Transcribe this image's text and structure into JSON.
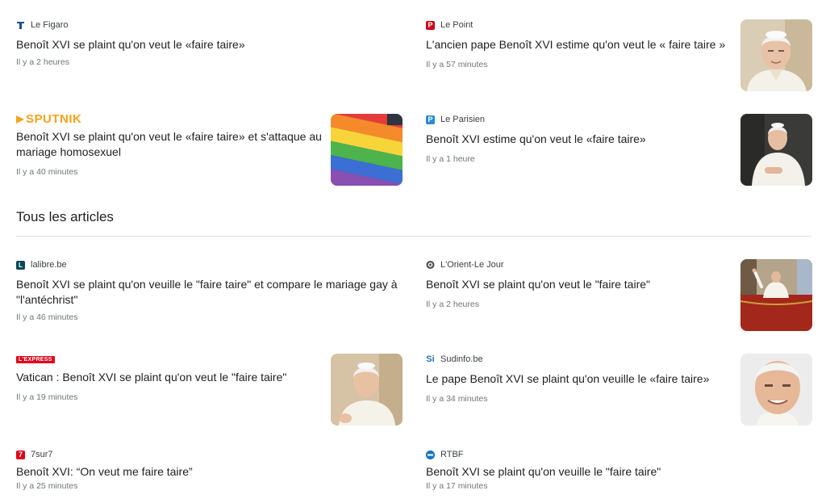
{
  "featured": [
    {
      "source": "Le Figaro",
      "headline": "Benoît XVI se plaint qu'on veut le «faire taire»",
      "time": "Il y a 2 heures"
    },
    {
      "source": "Le Point",
      "logo_letter": "P",
      "headline": "L'ancien pape Benoît XVI estime qu'on veut le « faire taire »",
      "time": "Il y a 57 minutes"
    },
    {
      "source": "SPUTNIK",
      "headline": "Benoît XVI se plaint qu'on veut le «faire taire» et s'attaque au mariage homosexuel",
      "time": "Il y a 40 minutes"
    },
    {
      "source": "Le Parisien",
      "logo_letter": "P",
      "headline": "Benoît XVI estime qu'on veut le «faire taire»",
      "time": "Il y a 1 heure"
    }
  ],
  "section": {
    "title": "Tous les articles"
  },
  "articles": [
    {
      "source": "lalibre.be",
      "logo_letter": "L",
      "headline": "Benoît XVI se plaint qu'on veuille le \"faire taire\" et compare le mariage gay à \"l'antéchrist\"",
      "time": "Il y a 46 minutes"
    },
    {
      "source": "L'Orient-Le Jour",
      "headline": "Benoît XVI se plaint qu'on veut le \"faire taire\"",
      "time": "Il y a 2 heures"
    },
    {
      "source": "L'EXPRESS",
      "headline": "Vatican : Benoît XVI se plaint qu'on veut le \"faire taire\"",
      "time": "Il y a 19 minutes"
    },
    {
      "source": "Sudinfo.be",
      "logo_letter": "Si",
      "headline": "Le pape Benoît XVI se plaint qu'on veuille le «faire taire»",
      "time": "Il y a 34 minutes"
    },
    {
      "source": "7sur7",
      "logo_letter": "7",
      "headline": "Benoît XVI: “On veut me faire taire”",
      "time": "Il y a 25 minutes"
    },
    {
      "source": "RTBF",
      "headline": "Benoît XVI se plaint qu'on veuille le \"faire taire\"",
      "time": "Il y a 17 minutes"
    }
  ],
  "colors": {
    "figaro": "#1a4e8a",
    "lepoint": "#d0021b",
    "leparisien": "#2a8ad6",
    "lalibre": "#0b4a5a",
    "sevensur7": "#e2001a",
    "rtbf": "#1e73be",
    "sudinfo": "#1e73be",
    "sputnik": "#f7a21b"
  },
  "icons": [
    "figaro-logo-icon",
    "lepoint-logo-icon",
    "sputnik-logo-icon",
    "leparisien-logo-icon",
    "lalibre-logo-icon",
    "lorient-logo-icon",
    "lexpress-logo-icon",
    "sudinfo-logo-icon",
    "7sur7-logo-icon",
    "rtbf-logo-icon"
  ]
}
